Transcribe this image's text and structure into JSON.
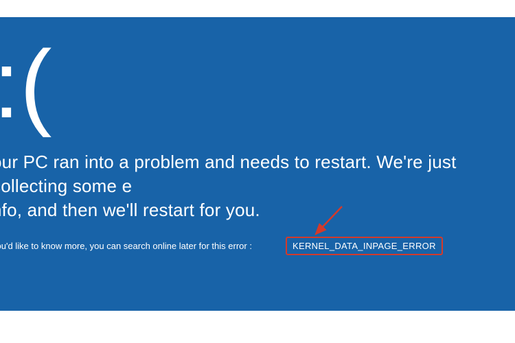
{
  "colors": {
    "background": "#1863a8",
    "text": "#ffffff",
    "highlight_border": "#d43a2a",
    "arrow": "#d43a2a"
  },
  "bsod": {
    "sad_face": ":(",
    "message": "our PC ran into a problem and needs to restart. We're just collecting some e\nnfo, and then we'll restart for you.",
    "detail_prefix": "you'd like to know more, you can search online later for this error :",
    "error_code": "KERNEL_DATA_INPAGE_ERROR"
  }
}
